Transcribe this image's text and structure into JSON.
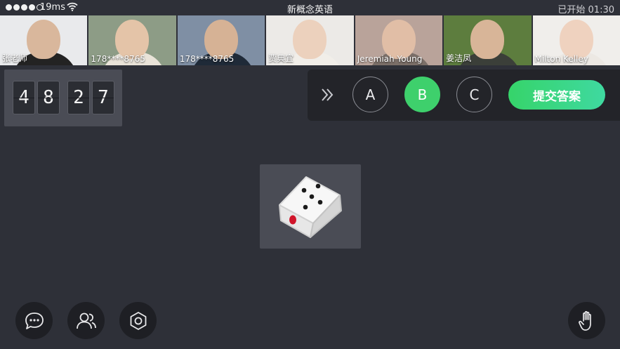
{
  "status_bar": {
    "latency": "19ms",
    "title": "新概念英语",
    "class_timer": "已开始 01:30"
  },
  "participants": [
    {
      "name": "张老师",
      "bg": "#e9eaec",
      "shirt": "#232323",
      "skin": "#d9b79c"
    },
    {
      "name": "178****8765",
      "bg": "#8d9c86",
      "shirt": "#e9e3d8",
      "skin": "#e4c4a8"
    },
    {
      "name": "178****8765",
      "bg": "#7f8fa4",
      "shirt": "#1f2a38",
      "skin": "#d6b295"
    },
    {
      "name": "贾典宜",
      "bg": "#eceae7",
      "shirt": "#f1eee9",
      "skin": "#ecd1bd"
    },
    {
      "name": "Jeremiah Young",
      "bg": "#b9a39a",
      "shirt": "#7b6f68",
      "skin": "#e1bea6"
    },
    {
      "name": "姜洁凤",
      "bg": "#5d7d3e",
      "shirt": "#3b3f39",
      "skin": "#d8b598"
    },
    {
      "name": "Milton Kelley",
      "bg": "#f0eeeb",
      "shirt": "#ece8e3",
      "skin": "#efd2bf"
    }
  ],
  "countdown": {
    "digits": [
      "4",
      "8",
      "2",
      "7"
    ],
    "separator": ":"
  },
  "answer_panel": {
    "options": [
      {
        "label": "A",
        "selected": false
      },
      {
        "label": "B",
        "selected": true
      },
      {
        "label": "C",
        "selected": false
      }
    ],
    "submit_label": "提交答案",
    "accent": "#3ed06c"
  },
  "dice": {
    "face_top_pips": 5,
    "face_side_pips": 1,
    "side_pip_color": "#d0152a"
  },
  "toolbar": {
    "left_buttons": [
      "chat-icon",
      "members-icon",
      "settings-icon"
    ],
    "right_button": "raise-hand-icon"
  }
}
